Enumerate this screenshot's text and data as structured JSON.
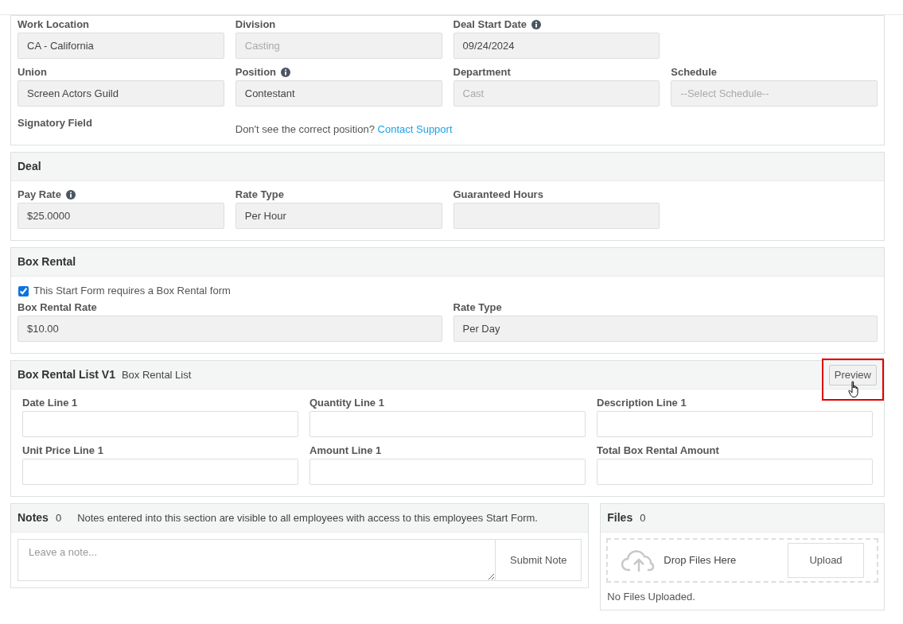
{
  "general": {
    "rows": [
      [
        {
          "label": "Work Location",
          "value": "CA - California",
          "info": false,
          "disabled": false
        },
        {
          "label": "Division",
          "value": "Casting",
          "info": false,
          "disabled": true
        },
        {
          "label": "Deal Start Date",
          "value": "09/24/2024",
          "info": true,
          "disabled": false
        }
      ],
      [
        {
          "label": "Union",
          "value": "Screen Actors Guild",
          "info": false,
          "disabled": false
        },
        {
          "label": "Position",
          "value": "Contestant",
          "info": true,
          "disabled": false
        },
        {
          "label": "Department",
          "value": "Cast",
          "info": false,
          "disabled": true
        },
        {
          "label": "Schedule",
          "placeholder": "--Select Schedule--",
          "info": false,
          "disabled": true
        }
      ]
    ],
    "signatory_label": "Signatory Field",
    "position_note": {
      "text": "Don't see the correct position?",
      "link": "Contact Support"
    }
  },
  "deal": {
    "title": "Deal",
    "fields": [
      {
        "label": "Pay Rate",
        "value": "$25.0000",
        "info": true,
        "disabled": false
      },
      {
        "label": "Rate Type",
        "value": "Per Hour",
        "info": false,
        "disabled": false
      },
      {
        "label": "Guaranteed Hours",
        "info": false
      }
    ]
  },
  "box_rental": {
    "title": "Box Rental",
    "checkbox": {
      "label": "This Start Form requires a Box Rental form",
      "checked": true
    },
    "fields": [
      {
        "label": "Box Rental Rate",
        "value": "$10.00",
        "info": false,
        "disabled": false
      },
      {
        "label": "Rate Type",
        "value": "Per Day",
        "info": false,
        "disabled": false
      }
    ]
  },
  "box_rental_list": {
    "title": "Box Rental List V1",
    "subtitle": "Box Rental List",
    "preview_button": "Preview",
    "fields": [
      {
        "label": "Date Line 1"
      },
      {
        "label": "Quantity Line 1"
      },
      {
        "label": "Description Line 1"
      },
      {
        "label": "Unit Price Line 1"
      },
      {
        "label": "Amount Line 1"
      },
      {
        "label": "Total Box Rental Amount"
      }
    ]
  },
  "notes": {
    "title": "Notes",
    "count": "0",
    "hint": "Notes entered into this section are visible to all employees with access to this employees Start Form.",
    "placeholder": "Leave a note...",
    "submit_button": "Submit Note"
  },
  "files": {
    "title": "Files",
    "count": "0",
    "drop_text": "Drop Files Here",
    "upload_button": "Upload",
    "empty_text": "No Files Uploaded."
  }
}
